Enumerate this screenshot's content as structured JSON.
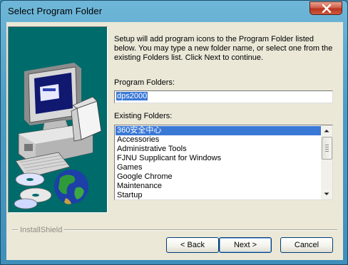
{
  "window": {
    "title": "Select Program Folder"
  },
  "intro_text": "Setup will add program icons to the Program Folder listed below. You may type a new folder name, or select one from the existing Folders list.  Click Next to continue.",
  "program_folders": {
    "label": "Program Folders:",
    "value": "dps2000"
  },
  "existing_folders": {
    "label": "Existing Folders:",
    "items": [
      "360安全中心",
      "Accessories",
      "Administrative Tools",
      "FJNU Supplicant for Windows",
      "Games",
      "Google Chrome",
      "Maintenance",
      "Startup"
    ],
    "selected": "360安全中心"
  },
  "brand": "InstallShield",
  "buttons": {
    "back": "< Back",
    "next": "Next >",
    "cancel": "Cancel"
  },
  "icons": [
    "close-icon",
    "scroll-up-arrow-icon",
    "scroll-down-arrow-icon",
    "computer-illustration",
    "cd-discs-illustration",
    "globe-illustration"
  ],
  "colors": {
    "selection": "#3a78d6",
    "art_background": "#006b6b",
    "dialog_face": "#ebe8d8"
  }
}
